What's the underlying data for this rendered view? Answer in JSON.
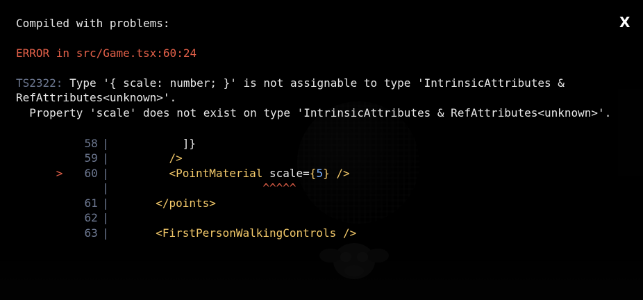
{
  "overlay": {
    "title": "Compiled with problems:",
    "close_label": "X",
    "error_location": "ERROR in src/Game.tsx:60:24",
    "error_code": "TS2322:",
    "message_line1": " Type '{ scale: number; }' is not assignable to type 'IntrinsicAttributes &",
    "message_line2": "RefAttributes<unknown>'.",
    "message_line3": "  Property 'scale' does not exist on type 'IntrinsicAttributes & RefAttributes<unknown>'."
  },
  "code_frame": {
    "rows": [
      {
        "marker": "",
        "line": "58",
        "gutter": "|",
        "text": "           ]}"
      },
      {
        "marker": "",
        "line": "59",
        "gutter": "|",
        "text": "         />"
      },
      {
        "marker": ">",
        "line": "60",
        "gutter": "|",
        "pre": "         ",
        "tag_open": "<PointMaterial",
        "attr": " scale=",
        "brace_open": "{",
        "num": "5",
        "brace_close": "}",
        "tag_close": " />"
      },
      {
        "marker": "",
        "line": "",
        "gutter": "|",
        "carets": "                       ^^^^^"
      },
      {
        "marker": "",
        "line": "61",
        "gutter": "|",
        "text": "       </points>"
      },
      {
        "marker": "",
        "line": "62",
        "gutter": "|",
        "text": ""
      },
      {
        "marker": "",
        "line": "63",
        "gutter": "|",
        "text": "       <FirstPersonWalkingControls />"
      }
    ]
  },
  "colors": {
    "error_red": "#e36049",
    "muted_blue_gray": "#6d7891",
    "jsx_tag_yellow": "#f3c96a",
    "number_blue": "#7fb3ff",
    "text": "#e8e8e8"
  }
}
